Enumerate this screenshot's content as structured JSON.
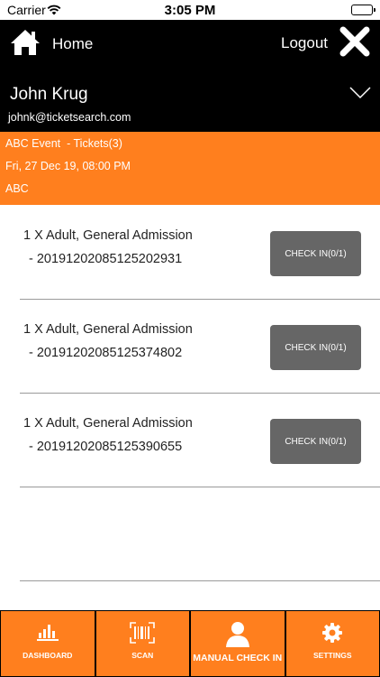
{
  "status_bar": {
    "carrier": "Carrier",
    "time": "3:05 PM"
  },
  "header": {
    "home_label": "Home",
    "logout_label": "Logout",
    "user_name": "John Krug",
    "user_email": "johnk@ticketsearch.com"
  },
  "event": {
    "line1": "ABC Event  - Tickets(3)",
    "line2": "Fri, 27 Dec 19, 08:00 PM",
    "line3": "ABC"
  },
  "tickets": [
    {
      "title": "1 X Adult, General Admission",
      "code": "- 20191202085125202931",
      "button": "CHECK IN(0/1)"
    },
    {
      "title": "1 X Adult, General Admission",
      "code": "- 20191202085125374802",
      "button": "CHECK IN(0/1)"
    },
    {
      "title": "1 X Adult, General Admission",
      "code": "- 20191202085125390655",
      "button": "CHECK IN(0/1)"
    }
  ],
  "tabs": [
    {
      "label": "DASHBOARD",
      "icon": "bar-chart-icon"
    },
    {
      "label": "SCAN",
      "icon": "barcode-icon"
    },
    {
      "label": "MANUAL CHECK IN",
      "icon": "person-icon"
    },
    {
      "label": "SETTINGS",
      "icon": "gear-icon"
    }
  ],
  "colors": {
    "accent": "#ff7f1e",
    "header_bg": "#000000",
    "button_gray": "#666666"
  }
}
